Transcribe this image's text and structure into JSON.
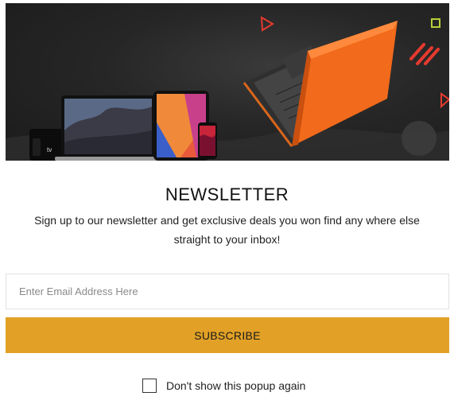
{
  "banner": {
    "icons": [
      "apple-tv-icon",
      "laptop-icon",
      "tablet-icon",
      "phone-icon",
      "orange-laptop-icon",
      "triangle-icon",
      "square-icon",
      "stripes-icon"
    ]
  },
  "newsletter": {
    "title": "NEWSLETTER",
    "description": "Sign up to our newsletter and get exclusive deals you won find any where else straight to your inbox!",
    "email_placeholder": "Enter Email Address Here",
    "email_value": "",
    "subscribe_label": "SUBSCRIBE",
    "dont_show_label": "Don't show this popup again",
    "dont_show_checked": false
  },
  "colors": {
    "accent": "#e2a126",
    "banner_bg": "#262626",
    "laptop_orange": "#f26a1b",
    "shape_red": "#e53a2f",
    "shape_lime": "#b8cf3a"
  }
}
